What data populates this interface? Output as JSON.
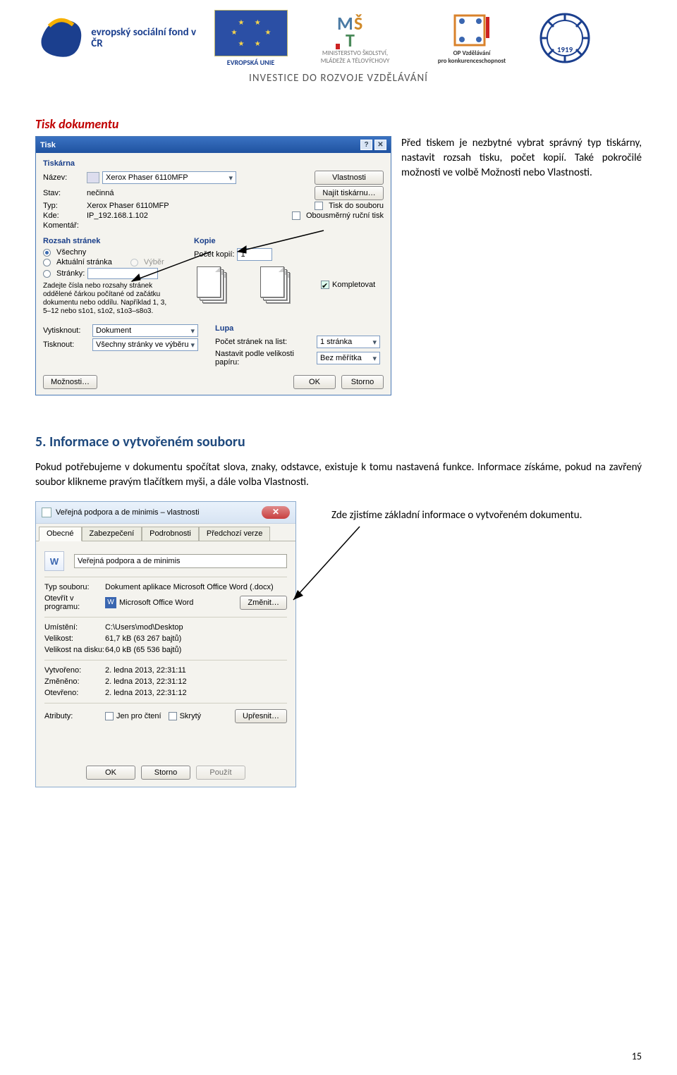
{
  "banner": {
    "subline": "INVESTICE DO ROZVOJE VZDĚLÁVÁNÍ",
    "esf": "evropský sociální fond v ČR",
    "eu": "EVROPSKÁ UNIE",
    "msmt1": "MINISTERSTVO ŠKOLSTVÍ,",
    "msmt2": "MLÁDEŽE A TĚLOVÝCHOVY",
    "op1": "OP Vzdělávání",
    "op2": "pro konkurenceschopnost",
    "wheel": "1919"
  },
  "sec_tisk": {
    "heading": "Tisk dokumentu",
    "para": "Před tiskem je nezbytné vybrat správný typ tiskárny, nastavit rozsah tisku, počet kopií. Také pokročilé možnosti ve volbě Možnosti nebo Vlastnosti."
  },
  "print_dialog": {
    "title": "Tisk",
    "printer_section": "Tiskárna",
    "name_lbl": "Název:",
    "name_val": "Xerox Phaser 6110MFP",
    "state_lbl": "Stav:",
    "state_val": "nečinná",
    "type_lbl": "Typ:",
    "type_val": "Xerox Phaser 6110MFP",
    "where_lbl": "Kde:",
    "where_val": "IP_192.168.1.102",
    "comment_lbl": "Komentář:",
    "btn_props": "Vlastnosti",
    "btn_find": "Najít tiskárnu…",
    "chk_tofile": "Tisk do souboru",
    "chk_duplex": "Obousměrný ruční tisk",
    "range_section": "Rozsah stránek",
    "r_all": "Všechny",
    "r_current": "Aktuální stránka",
    "r_sel": "Výběr",
    "r_pages": "Stránky:",
    "range_hint": "Zadejte čísla nebo rozsahy stránek oddělené čárkou počítané od začátku dokumentu nebo oddílu. Například 1, 3, 5–12 nebo s1o1, s1o2, s1o3–s8o3.",
    "copies_section": "Kopie",
    "copies_lbl": "Počet kopií:",
    "copies_val": "1",
    "collate": "Kompletovat",
    "printwhat_lbl": "Vytisknout:",
    "printwhat_val": "Dokument",
    "printsel_lbl": "Tisknout:",
    "printsel_val": "Všechny stránky ve výběru",
    "zoom_section": "Lupa",
    "zoom_pages_lbl": "Počet stránek na list:",
    "zoom_pages_val": "1 stránka",
    "zoom_scale_lbl": "Nastavit podle velikosti papíru:",
    "zoom_scale_val": "Bez měřítka",
    "btn_options": "Možnosti…",
    "btn_ok": "OK",
    "btn_cancel": "Storno"
  },
  "sec5": {
    "heading": "5. Informace o vytvořeném souboru",
    "para": "Pokud potřebujeme v dokumentu spočítat slova, znaky, odstavce, existuje k tomu nastavená funkce. Informace získáme, pokud na zavřený soubor klikneme pravým tlačítkem myši, a dále volba Vlastnosti.",
    "caption": "Zde zjistíme základní informace o vytvořeném dokumentu."
  },
  "props_dialog": {
    "title": "Veřejná podpora a de minimis – vlastnosti",
    "tabs": [
      "Obecné",
      "Zabezpečení",
      "Podrobnosti",
      "Předchozí verze"
    ],
    "docname": "Veřejná podpora a de minimis",
    "typ_lbl": "Typ souboru:",
    "typ_val": "Dokument aplikace Microsoft Office Word (.docx)",
    "open_lbl": "Otevřít v programu:",
    "open_val": "Microsoft Office Word",
    "btn_change": "Změnit…",
    "loc_lbl": "Umístění:",
    "loc_val": "C:\\Users\\mod\\Desktop",
    "size_lbl": "Velikost:",
    "size_val": "61,7 kB (63 267 bajtů)",
    "sizedisk_lbl": "Velikost na disku:",
    "sizedisk_val": "64,0 kB (65 536 bajtů)",
    "created_lbl": "Vytvořeno:",
    "created_val": "2. ledna 2013, 22:31:11",
    "modified_lbl": "Změněno:",
    "modified_val": "2. ledna 2013, 22:31:12",
    "accessed_lbl": "Otevřeno:",
    "accessed_val": "2. ledna 2013, 22:31:12",
    "attr_lbl": "Atributy:",
    "attr_ro": "Jen pro čtení",
    "attr_hidden": "Skrytý",
    "btn_adv": "Upřesnit…",
    "btn_ok": "OK",
    "btn_cancel": "Storno",
    "btn_apply": "Použít"
  },
  "page_number": "15"
}
